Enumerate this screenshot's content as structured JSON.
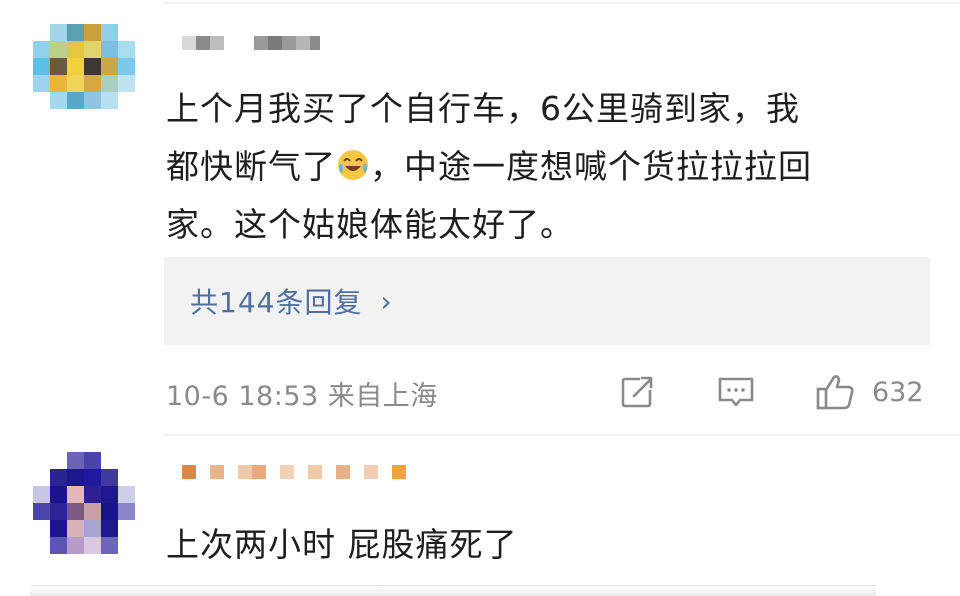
{
  "comments": [
    {
      "text_line1": "上个月我买了个自行车，6公里骑到家，我",
      "text_line2a": "都快断气了",
      "emoji": "laughing-tears-emoji",
      "text_line2b": "，中途一度想喊个货拉拉拉回",
      "text_line3": "家。这个姑娘体能太好了。",
      "replies_label": "共144条回复",
      "replies_chevron": "›",
      "meta": "10-6 18:53 来自上海",
      "like_count": "632"
    },
    {
      "text": "上次两小时 屁股痛死了"
    }
  ],
  "colors": {
    "link": "#4f6fa0",
    "meta": "#8a8a8a",
    "reply_bg": "#f2f2f2"
  },
  "icons": {
    "share": "share-icon",
    "comment": "comment-icon",
    "like": "thumbs-up-icon"
  }
}
